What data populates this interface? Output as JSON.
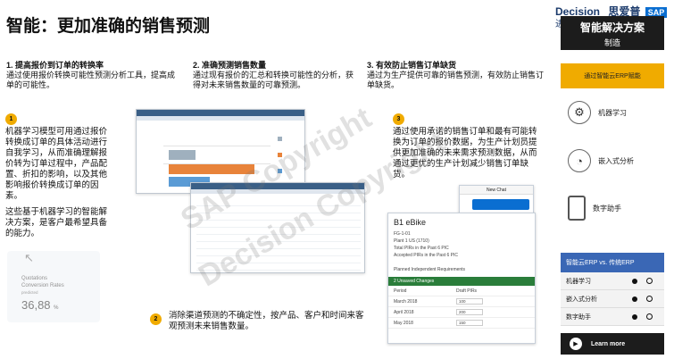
{
  "title": "智能：更加准确的销售预测",
  "logo": {
    "brand": "Decision",
    "sub": "进",
    "cn": "思爱普",
    "sap": "SAP"
  },
  "right_panel": {
    "header_line1": "智能解决方案",
    "header_line2": "制造",
    "tab_label": "通过智能云ERP赋能",
    "features": [
      {
        "icon": "brain-icon",
        "label": "机器学习"
      },
      {
        "icon": "analytics-icon",
        "label": "嵌入式分析"
      },
      {
        "icon": "phone-icon",
        "label": "数字助手"
      }
    ],
    "compare_header": "智能云ERP vs. 传统ERP",
    "compare_rows": [
      {
        "label": "机器学习"
      },
      {
        "label": "嵌入式分析"
      },
      {
        "label": "数字助手"
      }
    ],
    "learn_more": "Learn more",
    "colors": {
      "accent": "#f0ab00",
      "blue": "#3a67b5",
      "dark": "#1c1c1c"
    }
  },
  "sections": [
    {
      "title": "1. 提高报价到订单的转换率",
      "text": "通过使用报价转换可能性预测分析工具，提高成单的可能性。"
    },
    {
      "title": "2. 准确预测销售数量",
      "text": "通过现有报价的汇总和转换可能性的分析，获得对未来销售数量的可靠预测。"
    },
    {
      "title": "3. 有效防止销售订单缺货",
      "text": "通过为生产提供可靠的销售预测，有效防止销售订单缺货。"
    }
  ],
  "bullets": {
    "b1": "1",
    "b2": "2",
    "b3": "3"
  },
  "para1": "机器学习模型可用通过报价转换成订单的具体活动进行自我学习，从而准确理解报价转为订单过程中，产品配置、折扣的影响，以及其他影响报价转换成订单的因素。",
  "para1b": "这些基于机器学习的智能解决方案，是客户最希望具备的能力。",
  "para2": "消除渠道预测的不确定性，按产品、客户和时间来客观预测未来销售数量。",
  "para3": "通过使用承诺的销售订单和最有可能转换为订单的报价数据，为生产计划员提供更加准确的未来需求预测数据，从而通过更优的生产计划减少销售订单缺货。",
  "kpi": {
    "line1": "Quotations",
    "line2": "Conversion Rates",
    "line3": "predicted",
    "value": "36,88",
    "unit": "%"
  },
  "chat": {
    "title": "New Chat"
  },
  "bike": {
    "title": "B1 eBike",
    "lines": [
      "FG-1-01",
      "Plant 1 US (1710)",
      "Total PIRs in the Past 6 PIC",
      "Accepted PIRs in the Past 6 PIC"
    ],
    "section": "Planned Independent Requirements",
    "tab": "2 Unsaved Changes",
    "col1": "Period",
    "col2": "Draft PIRs",
    "rows": [
      {
        "period": "March 2018",
        "value": "100"
      },
      {
        "period": "April 2018",
        "value": "200"
      },
      {
        "period": "May 2018",
        "value": "150"
      }
    ]
  }
}
